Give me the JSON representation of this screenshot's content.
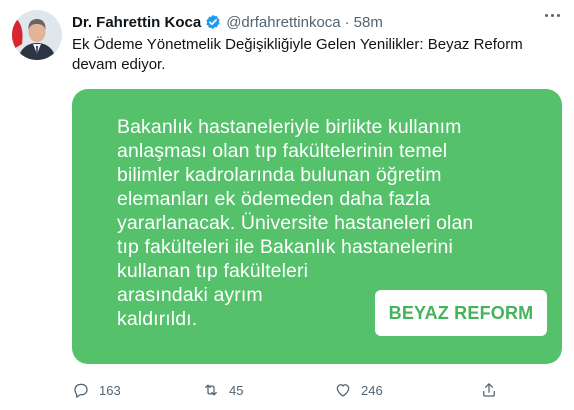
{
  "tweet": {
    "display_name": "Dr. Fahrettin Koca",
    "handle": "@drfahrettinkoca",
    "separator": "·",
    "time": "58m",
    "text": "Ek Ödeme Yönetmelik Değişikliğiyle Gelen Yenilikler: Beyaz Reform devam ediyor.",
    "verified": true
  },
  "media": {
    "lines": [
      "Bakanlık hastaneleriyle birlikte kullanım",
      "anlaşması olan tıp fakültelerinin temel",
      "bilimler kadrolarında bulunan öğretim",
      "elemanları ek ödemeden daha fazla",
      "yararlanacak. Üniversite hastaneleri olan",
      "tıp fakülteleri ile Bakanlık hastanelerini",
      "kullanan tıp fakülteleri",
      "arasındaki ayrım",
      "kaldırıldı."
    ],
    "badge": "BEYAZ REFORM",
    "background_color": "#55c16b",
    "badge_text_color": "#45b35c"
  },
  "actions": {
    "reply_count": "163",
    "retweet_count": "45",
    "like_count": "246"
  },
  "icons": {
    "verified": "verified-badge-icon",
    "reply": "reply-icon",
    "retweet": "retweet-icon",
    "like": "heart-icon",
    "share": "share-icon",
    "more": "more-options-icon"
  },
  "colors": {
    "verified_blue": "#1d9bf0",
    "secondary_text": "#536471"
  }
}
